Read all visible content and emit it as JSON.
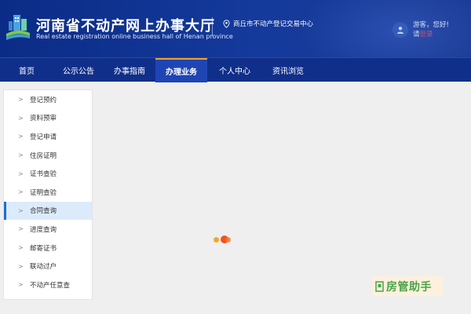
{
  "header": {
    "title": "河南省不动产网上办事大厅",
    "subtitle": "Real estate registration online business hall of Henan province",
    "location": "商丘市不动产登记交易中心",
    "greeting": "游客，您好!",
    "login_prefix": "请",
    "login_label": "登录"
  },
  "nav": {
    "items": [
      {
        "label": "首页"
      },
      {
        "label": "公示公告"
      },
      {
        "label": "办事指南"
      },
      {
        "label": "办理业务"
      },
      {
        "label": "个人中心"
      },
      {
        "label": "资讯浏览"
      }
    ],
    "active": "办理业务"
  },
  "sidebar": {
    "items": [
      {
        "label": "登记预约"
      },
      {
        "label": "资料预审"
      },
      {
        "label": "登记申请"
      },
      {
        "label": "住房证明"
      },
      {
        "label": "证书查验"
      },
      {
        "label": "证明查验"
      },
      {
        "label": "合同查询"
      },
      {
        "label": "进度查询"
      },
      {
        "label": "邮寄证书"
      },
      {
        "label": "联动过户"
      },
      {
        "label": "不动产任意查"
      }
    ],
    "active": "合同查询"
  },
  "watermark": {
    "text": "房管助手"
  },
  "colors": {
    "header_bg": "#0b2c86",
    "nav_bg": "#102f8a",
    "nav_active": "#1f45b4",
    "nav_active_border": "#f2a02a",
    "sidebar_active_bg": "#dcebfb",
    "sidebar_active_bar": "#1a6de0",
    "login_link": "#ff3b3b",
    "loader_orange": "#f5a623",
    "loader_red": "#f0521f"
  }
}
